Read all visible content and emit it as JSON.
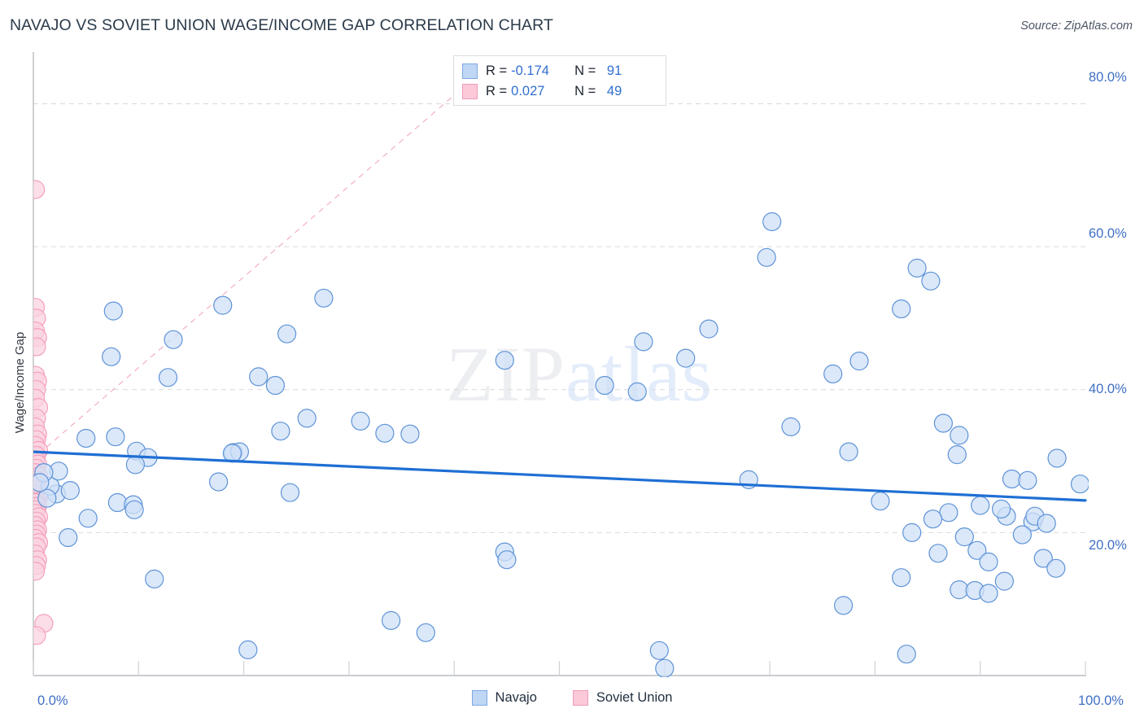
{
  "header": {
    "title": "NAVAJO VS SOVIET UNION WAGE/INCOME GAP CORRELATION CHART",
    "source": "Source: ZipAtlas.com"
  },
  "watermark": {
    "part1": "ZIP",
    "part2": "atlas"
  },
  "stats": {
    "rows": [
      {
        "series": "Navajo",
        "r_label": "R =",
        "r_value": "-0.174",
        "n_label": "N =",
        "n_value": "91",
        "color": "#bfd6f5"
      },
      {
        "series": "Soviet Union",
        "r_label": "R =",
        "r_value": "0.027",
        "n_label": "N =",
        "n_value": "49",
        "color": "#fbc9d8"
      }
    ]
  },
  "legend": {
    "entries": [
      {
        "label": "Navajo",
        "color": "#bfd6f5"
      },
      {
        "label": "Soviet Union",
        "color": "#fbc9d8"
      }
    ]
  },
  "axes": {
    "y_title": "Wage/Income Gap",
    "y_ticks": [
      "80.0%",
      "60.0%",
      "40.0%",
      "20.0%"
    ],
    "x_ticks": [
      "0.0%",
      "100.0%"
    ]
  },
  "chart_data": {
    "type": "scatter",
    "title": "NAVAJO VS SOVIET UNION WAGE/INCOME GAP CORRELATION CHART",
    "xlabel": "",
    "ylabel": "Wage/Income Gap",
    "xlim": [
      0,
      100
    ],
    "ylim": [
      0,
      87
    ],
    "x_tick_values": [
      0,
      100
    ],
    "y_tick_values": [
      20,
      40,
      60,
      80
    ],
    "grid": "horizontal-dashed",
    "legend_position": "bottom-center",
    "point_radius_px": 11,
    "series": [
      {
        "name": "Navajo",
        "color_fill": "#cfe0f7",
        "color_stroke": "#5e93d8",
        "R": -0.174,
        "N": 91,
        "trend": {
          "type": "solid",
          "color": "#1f6fd4",
          "x0": 0.0,
          "y0": 31.3,
          "x1": 100.0,
          "y1": 24.5
        },
        "points": [
          [
            7.6,
            51.0
          ],
          [
            7.4,
            44.6
          ],
          [
            12.8,
            41.7
          ],
          [
            13.3,
            47.0
          ],
          [
            18.0,
            51.8
          ],
          [
            24.1,
            47.8
          ],
          [
            27.6,
            52.8
          ],
          [
            21.4,
            41.8
          ],
          [
            23.0,
            40.6
          ],
          [
            26.0,
            36.0
          ],
          [
            31.1,
            35.6
          ],
          [
            23.5,
            34.2
          ],
          [
            33.4,
            33.9
          ],
          [
            35.8,
            33.8
          ],
          [
            5.0,
            33.2
          ],
          [
            7.8,
            33.4
          ],
          [
            9.8,
            31.4
          ],
          [
            10.9,
            30.5
          ],
          [
            19.0,
            31.2
          ],
          [
            19.6,
            31.3
          ],
          [
            18.9,
            31.1
          ],
          [
            9.7,
            29.5
          ],
          [
            44.8,
            44.1
          ],
          [
            62.0,
            44.4
          ],
          [
            57.4,
            39.7
          ],
          [
            54.3,
            40.6
          ],
          [
            64.2,
            48.5
          ],
          [
            58.0,
            46.7
          ],
          [
            70.2,
            63.5
          ],
          [
            69.7,
            58.5
          ],
          [
            84.0,
            57.0
          ],
          [
            85.3,
            55.2
          ],
          [
            82.5,
            51.3
          ],
          [
            78.5,
            44.0
          ],
          [
            76.0,
            42.2
          ],
          [
            72.0,
            34.8
          ],
          [
            86.5,
            35.3
          ],
          [
            88.0,
            33.6
          ],
          [
            87.8,
            30.9
          ],
          [
            77.5,
            31.3
          ],
          [
            68.0,
            27.4
          ],
          [
            80.5,
            24.4
          ],
          [
            93.0,
            27.5
          ],
          [
            94.5,
            27.3
          ],
          [
            97.3,
            30.4
          ],
          [
            99.5,
            26.8
          ],
          [
            87.0,
            22.8
          ],
          [
            90.0,
            23.8
          ],
          [
            92.5,
            22.3
          ],
          [
            92.0,
            23.3
          ],
          [
            95.0,
            21.5
          ],
          [
            95.2,
            22.3
          ],
          [
            96.3,
            21.3
          ],
          [
            94.0,
            19.7
          ],
          [
            85.5,
            21.9
          ],
          [
            83.5,
            20.0
          ],
          [
            88.5,
            19.4
          ],
          [
            86.0,
            17.1
          ],
          [
            89.7,
            17.5
          ],
          [
            90.8,
            15.9
          ],
          [
            96.0,
            16.4
          ],
          [
            97.2,
            15.0
          ],
          [
            82.5,
            13.7
          ],
          [
            88.0,
            12.0
          ],
          [
            89.5,
            11.9
          ],
          [
            90.8,
            11.5
          ],
          [
            92.3,
            13.2
          ],
          [
            77.0,
            9.8
          ],
          [
            83.0,
            3.0
          ],
          [
            59.5,
            3.5
          ],
          [
            60.0,
            1.0
          ],
          [
            20.4,
            3.6
          ],
          [
            34.0,
            7.7
          ],
          [
            37.3,
            6.0
          ],
          [
            44.8,
            17.3
          ],
          [
            45.0,
            16.2
          ],
          [
            11.5,
            13.5
          ],
          [
            3.3,
            19.3
          ],
          [
            5.2,
            22.0
          ],
          [
            8.0,
            24.2
          ],
          [
            9.5,
            23.9
          ],
          [
            9.6,
            23.2
          ],
          [
            17.6,
            27.1
          ],
          [
            24.4,
            25.6
          ],
          [
            2.2,
            25.4
          ],
          [
            3.5,
            25.9
          ],
          [
            1.6,
            26.5
          ],
          [
            1.3,
            24.8
          ],
          [
            2.4,
            28.6
          ],
          [
            1.0,
            28.4
          ],
          [
            0.6,
            27.0
          ]
        ]
      },
      {
        "name": "Soviet Union",
        "color_fill": "#fbd3e0",
        "color_stroke": "#f4a0bd",
        "R": 0.027,
        "N": 49,
        "trend": {
          "type": "dashed",
          "color": "#f2a8bf",
          "x0": 0.5,
          "y0": 31.0,
          "x1": 43.0,
          "y1": 85.0
        },
        "points": [
          [
            0.2,
            68.0
          ],
          [
            0.2,
            51.5
          ],
          [
            0.3,
            50.0
          ],
          [
            0.2,
            48.2
          ],
          [
            0.4,
            47.3
          ],
          [
            0.3,
            46.0
          ],
          [
            0.2,
            42.0
          ],
          [
            0.4,
            41.2
          ],
          [
            0.3,
            40.0
          ],
          [
            0.2,
            38.8
          ],
          [
            0.5,
            37.5
          ],
          [
            0.3,
            36.0
          ],
          [
            0.2,
            34.8
          ],
          [
            0.4,
            33.8
          ],
          [
            0.3,
            33.0
          ],
          [
            0.2,
            32.2
          ],
          [
            0.5,
            31.5
          ],
          [
            0.3,
            30.8
          ],
          [
            0.2,
            30.2
          ],
          [
            0.4,
            29.6
          ],
          [
            0.3,
            29.0
          ],
          [
            0.2,
            28.4
          ],
          [
            0.5,
            27.9
          ],
          [
            0.3,
            27.4
          ],
          [
            0.2,
            27.0
          ],
          [
            0.4,
            26.5
          ],
          [
            0.3,
            26.0
          ],
          [
            0.2,
            25.5
          ],
          [
            0.5,
            25.0
          ],
          [
            0.3,
            24.6
          ],
          [
            0.2,
            24.2
          ],
          [
            0.4,
            23.7
          ],
          [
            0.3,
            23.2
          ],
          [
            0.2,
            22.7
          ],
          [
            0.5,
            22.2
          ],
          [
            0.3,
            21.6
          ],
          [
            0.2,
            21.0
          ],
          [
            0.4,
            20.4
          ],
          [
            0.3,
            19.8
          ],
          [
            0.2,
            19.2
          ],
          [
            0.5,
            18.6
          ],
          [
            0.3,
            18.0
          ],
          [
            0.2,
            17.0
          ],
          [
            0.4,
            16.2
          ],
          [
            0.3,
            15.4
          ],
          [
            0.2,
            14.6
          ],
          [
            1.0,
            7.3
          ],
          [
            0.3,
            5.6
          ],
          [
            0.2,
            26.8
          ]
        ]
      }
    ]
  }
}
